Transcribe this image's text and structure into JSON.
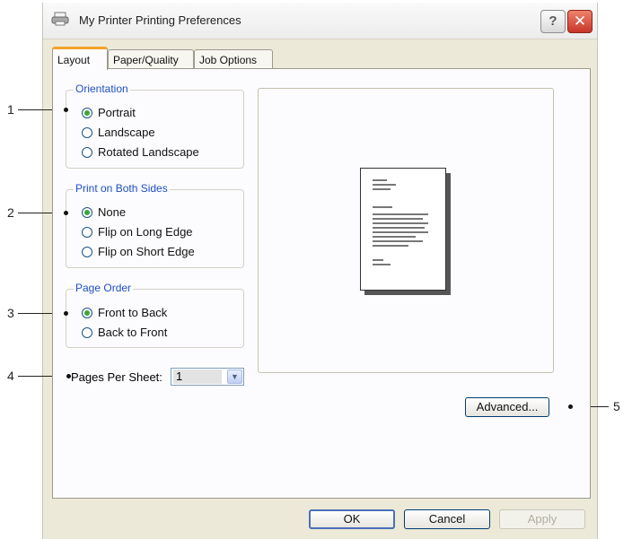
{
  "window": {
    "title": "My Printer Printing Preferences",
    "help_glyph": "?",
    "close_glyph": "✕",
    "accent": "#f4a32a",
    "close_color": "#c7362a"
  },
  "tabs": [
    {
      "label": "Layout",
      "active": true
    },
    {
      "label": "Paper/Quality",
      "active": false
    },
    {
      "label": "Job Options",
      "active": false
    }
  ],
  "orientation": {
    "title": "Orientation",
    "options": [
      {
        "label": "Portrait",
        "selected": true
      },
      {
        "label": "Landscape",
        "selected": false
      },
      {
        "label": "Rotated Landscape",
        "selected": false
      }
    ]
  },
  "duplex": {
    "title": "Print on Both Sides",
    "options": [
      {
        "label": "None",
        "selected": true
      },
      {
        "label": "Flip on Long Edge",
        "selected": false
      },
      {
        "label": "Flip on Short Edge",
        "selected": false
      }
    ]
  },
  "page_order": {
    "title": "Page Order",
    "options": [
      {
        "label": "Front to Back",
        "selected": true
      },
      {
        "label": "Back to Front",
        "selected": false
      }
    ]
  },
  "pages_per_sheet": {
    "label": "Pages Per Sheet:",
    "value": "1"
  },
  "buttons": {
    "advanced": "Advanced...",
    "ok": "OK",
    "cancel": "Cancel",
    "apply": "Apply"
  },
  "callouts": [
    "1",
    "2",
    "3",
    "4",
    "5"
  ]
}
